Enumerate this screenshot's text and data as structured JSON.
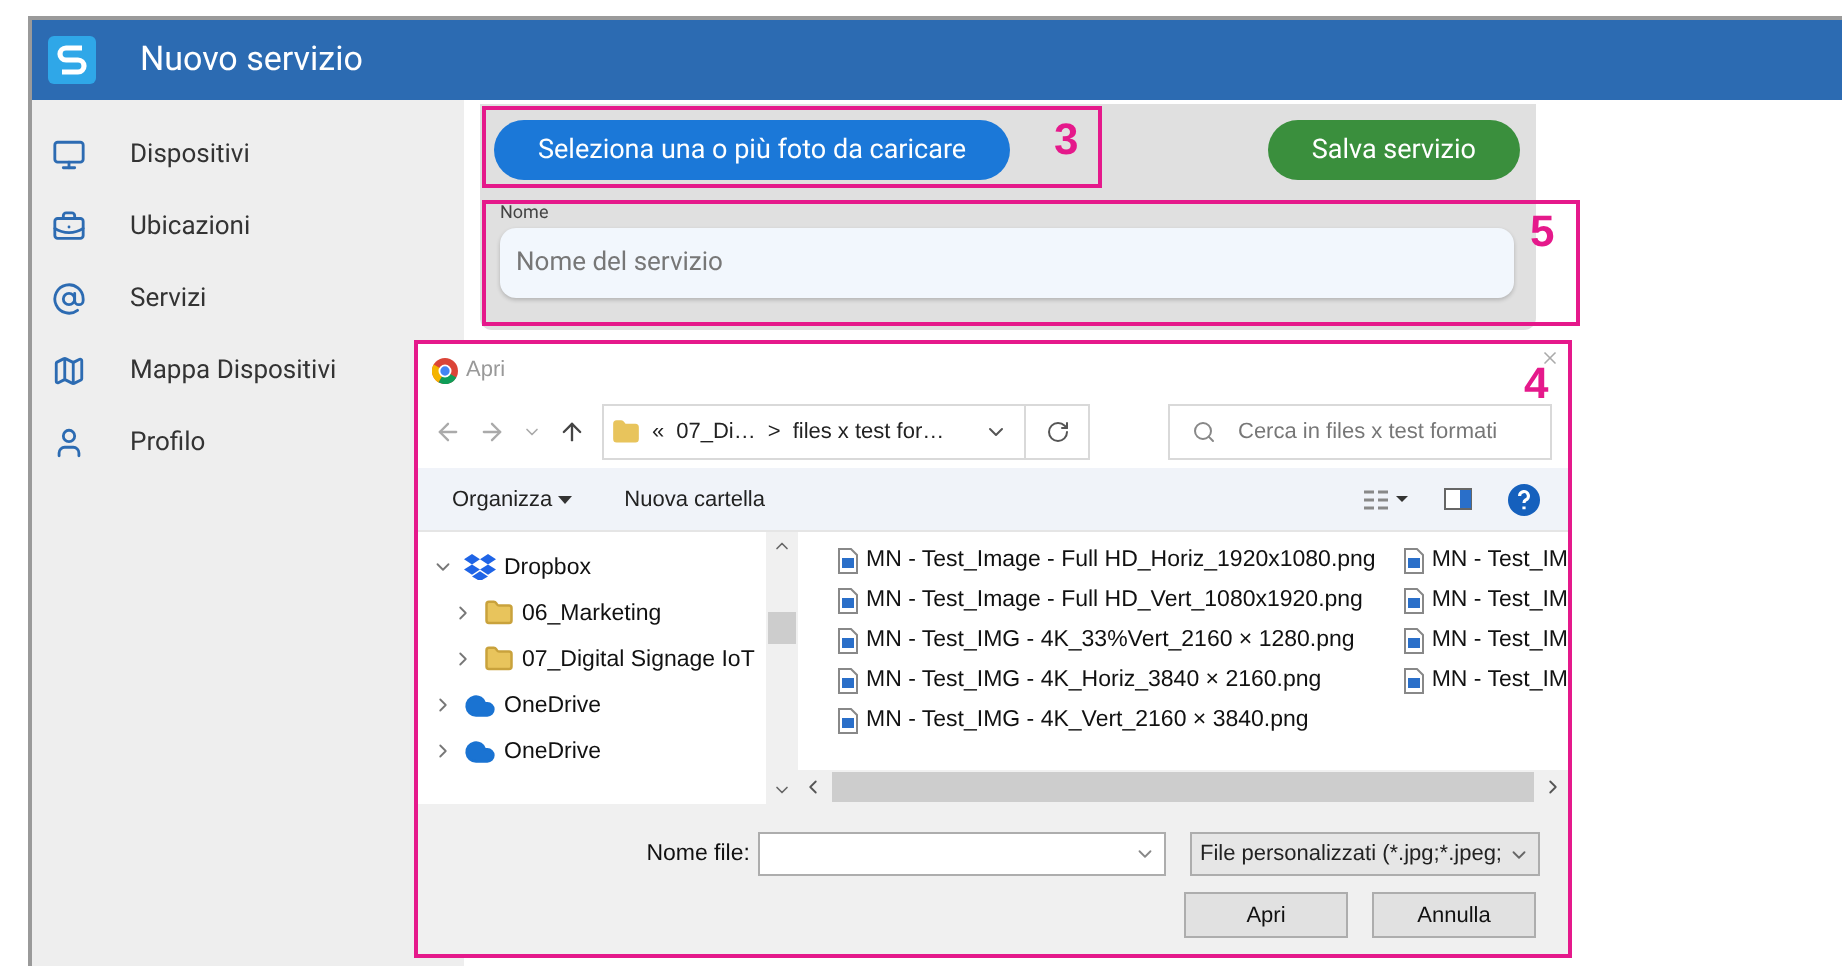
{
  "app_bar": {
    "title": "Nuovo servizio"
  },
  "sidebar": {
    "items": [
      {
        "label": "Dispositivi"
      },
      {
        "label": "Ubicazioni"
      },
      {
        "label": "Servizi"
      },
      {
        "label": "Mappa Dispositivi"
      },
      {
        "label": "Profilo"
      }
    ]
  },
  "form": {
    "upload_button": "Seleziona una o più foto da caricare",
    "save_button": "Salva servizio",
    "name_label": "Nome",
    "name_placeholder": "Nome del servizio"
  },
  "annotations": [
    {
      "number": "3"
    },
    {
      "number": "5"
    },
    {
      "number": "4"
    }
  ],
  "dialog": {
    "title": "Apri",
    "address": {
      "overflow": "«",
      "parent": "07_Di…",
      "separator": ">",
      "current": "files x test for…"
    },
    "search": {
      "placeholder": "Cerca in files x test formati"
    },
    "toolbar": {
      "organize": "Organizza",
      "new_folder": "Nuova cartella"
    },
    "tree": [
      {
        "label": "Dropbox",
        "kind": "dropbox",
        "expanded": true,
        "children": [
          {
            "label": "06_Marketing",
            "kind": "folder",
            "expanded": false
          },
          {
            "label": "07_Digital Signage IoT",
            "kind": "folder",
            "expanded": false
          }
        ]
      },
      {
        "label": "OneDrive",
        "kind": "cloud",
        "expanded": false
      },
      {
        "label": "OneDrive",
        "kind": "cloud",
        "expanded": false
      }
    ],
    "files": [
      {
        "name": "MN - Test_Image - Full HD_Horiz_1920x1080.png"
      },
      {
        "name": "MN - Test_Image - Full HD_Vert_1080x1920.png"
      },
      {
        "name": "MN - Test_IMG - 4K_33%Vert_2160 × 1280.png"
      },
      {
        "name": "MN - Test_IMG - 4K_Horiz_3840 × 2160.png"
      },
      {
        "name": "MN - Test_IMG - 4K_Vert_2160 × 3840.png"
      },
      {
        "name": "MN - Test_IM"
      },
      {
        "name": "MN - Test_IM"
      },
      {
        "name": "MN - Test_IM"
      },
      {
        "name": "MN - Test_IM"
      }
    ],
    "file_name_label": "Nome file:",
    "file_type": "File personalizzati (*.jpg;*.jpeg;",
    "buttons": [
      "Apri",
      "Annulla"
    ]
  }
}
